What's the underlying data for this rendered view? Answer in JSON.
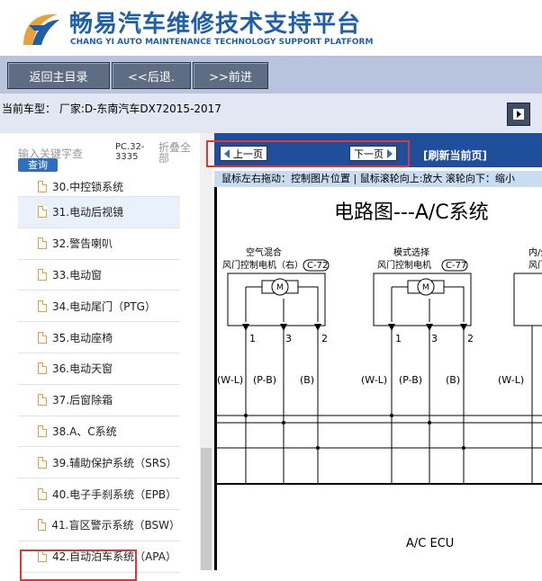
{
  "header": {
    "title": "畅易汽车维修技术支持平台",
    "subtitle": "CHANG YI AUTO MAINTENANCE TECHNOLOGY SUPPORT PLATFORM"
  },
  "toolbar": {
    "home_label": "返回主目录",
    "back_label": "<<后退.",
    "forward_label": ">>前进"
  },
  "model_line": "当前车型： 厂家:D-东南汽车DX72015-2017",
  "sidebar": {
    "keyword_placeholder": "输入关键字查",
    "query_label": "查询",
    "pc_code": "PC.32-3335",
    "collapse_label": "折叠全部",
    "items": [
      {
        "label": "30.中控锁系统"
      },
      {
        "label": "31.电动后视镜"
      },
      {
        "label": "32.警告喇叭"
      },
      {
        "label": "33.电动窗"
      },
      {
        "label": "34.电动尾门（PTG）"
      },
      {
        "label": "35.电动座椅"
      },
      {
        "label": "36.电动天窗"
      },
      {
        "label": "37.后窗除霜"
      },
      {
        "label": "38.A、C系统"
      },
      {
        "label": "39.辅助保护系统（SRS）"
      },
      {
        "label": "40.电子手刹系统（EPB）"
      },
      {
        "label": "41.盲区警示系统（BSW）"
      },
      {
        "label": "42.自动泊车系统（APA）"
      }
    ]
  },
  "content": {
    "prev_label": "上一页",
    "next_label": "下一页",
    "refresh_label": "[刷新当前页]",
    "hint": "鼠标左右拖动：控制图片位置 | 鼠标滚轮向上:放大  滚轮向下：缩小"
  },
  "diagram": {
    "title": "电路图---A/C系统",
    "motor1_line1": "空气混合",
    "motor1_line2": "风门控制电机（右）",
    "motor1_code": "C-72",
    "motor2_line1": "模式选择",
    "motor2_line2": "风门控制电机",
    "motor2_code": "C-77",
    "motor3_line1": "内/外",
    "motor3_line2": "风门",
    "motor_symbol": "M",
    "pins": [
      "1",
      "3",
      "2"
    ],
    "wires": [
      "(W-L)",
      "(P-B)",
      "(B)"
    ],
    "ecu_label": "A/C  ECU"
  },
  "colors": {
    "brand_blue": "#1f5fa8",
    "toolbar_bg": "#b8c3de",
    "button_bg": "#5e6c84",
    "nav_strip": "#1f4f9b",
    "highlight_red": "#d83a3a"
  }
}
